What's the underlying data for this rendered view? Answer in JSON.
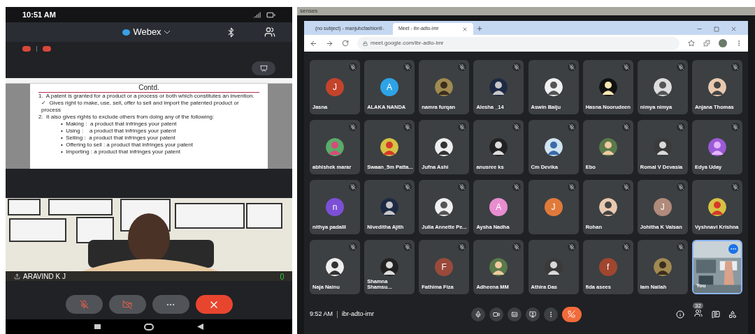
{
  "phone": {
    "status_bar": {
      "time": "10:51 AM"
    },
    "header": {
      "app_name": "Webex"
    },
    "slide": {
      "title": "Contd.",
      "items": [
        {
          "kind": "numbered",
          "text": "1.  A patent is granted for a product or a process or both which constitutes an invention."
        },
        {
          "kind": "check",
          "text": "✓  Gives right to make, use, sell, offer to sell and import the patented product or process"
        },
        {
          "kind": "numbered",
          "text": "2.  It also gives rights to exclude others from doing any of the following:"
        },
        {
          "kind": "bullet",
          "text": "•  Making :  a product that infringes your patent"
        },
        {
          "kind": "bullet",
          "text": "•  Using :    a product that infringes your patent"
        },
        {
          "kind": "bullet",
          "text": "•  Selling :  a product that infringes your patent"
        },
        {
          "kind": "bullet",
          "text": "•  Offering to sell : a product that infringes your patent"
        },
        {
          "kind": "bullet",
          "text": "•  Importing : a product that infringes your patent"
        }
      ]
    },
    "video": {
      "kind": "picture",
      "name": "ARAVIND K J"
    }
  },
  "monitor": {
    "brand": "senses",
    "tabs": [
      {
        "label": "(no subject) - manjuhcfashion9",
        "selected": false
      },
      {
        "label": "Meet - ibr-adto-imr",
        "selected": true
      }
    ],
    "address": "meet.google.com/ibr-adto-imr",
    "tiles": [
      {
        "name": "Jasna",
        "kind": "letter",
        "letter": "J",
        "color": "#c4432b"
      },
      {
        "name": "ALAKA NANDA",
        "kind": "letter",
        "letter": "A",
        "color": "#2ea3e6"
      },
      {
        "name": "namra furqan"
      },
      {
        "name": "Alesha _14"
      },
      {
        "name": "Aswin Baiju"
      },
      {
        "name": "Hasna Noorudeen"
      },
      {
        "name": "nimya nimya"
      },
      {
        "name": "Anjana Thomas"
      },
      {
        "name": "abhishek marar"
      },
      {
        "name": "Swaan_5m Patta..."
      },
      {
        "name": "Jufna Ashi"
      },
      {
        "name": "anusree ks"
      },
      {
        "name": "Cm Devika"
      },
      {
        "name": "Ebo"
      },
      {
        "name": "Romal V Devasia"
      },
      {
        "name": "Edya Uday"
      },
      {
        "name": "nithya padalil",
        "kind": "letter",
        "letter": "n",
        "color": "#7b4fd6"
      },
      {
        "name": "Niveditha Ajith"
      },
      {
        "name": "Julia Annette Pe..."
      },
      {
        "name": "Aysha Nadha",
        "kind": "letter",
        "letter": "A",
        "color": "#e88dcf"
      },
      {
        "kind": "letter",
        "letter": "J",
        "color": "#e07a3a"
      },
      {
        "name": "Rohan"
      },
      {
        "name": "Johitha K Valsan",
        "kind": "letter",
        "letter": "J",
        "color": "#b08a7a"
      },
      {
        "name": "Vyshnavi Krishna"
      },
      {
        "name": "Naja Nainu"
      },
      {
        "name": "Shamna Shamsu..."
      },
      {
        "name": "Fathima Fiza",
        "kind": "letter",
        "letter": "F",
        "color": "#9a4a3a"
      },
      {
        "name": "Adheena MM"
      },
      {
        "name": "Athira Das"
      },
      {
        "name": "fida asees",
        "kind": "letter",
        "letter": "f",
        "color": "#a0462f"
      },
      {
        "name": "Iam Nailah"
      },
      {
        "name": "You",
        "kind": "self"
      }
    ],
    "bottom_bar": {
      "time": "9:52 AM",
      "meeting_code": "ibr-adto-imr",
      "participant_count": "32"
    }
  }
}
